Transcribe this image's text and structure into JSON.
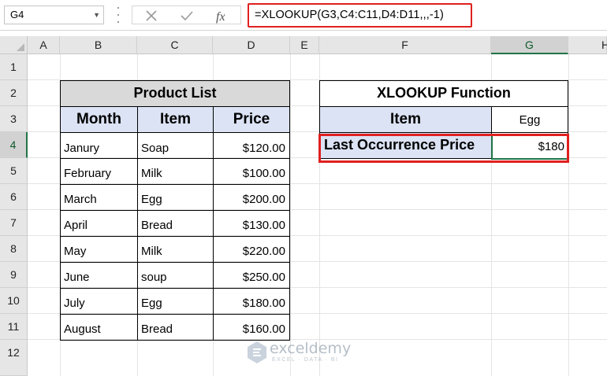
{
  "formula_bar": {
    "name_box": "G4",
    "icons": [
      "cancel-icon",
      "enter-icon",
      "function-icon"
    ],
    "formula": "=XLOOKUP(G3,C4:C11,D4:D11,,,-1)"
  },
  "columns": [
    "A",
    "B",
    "C",
    "D",
    "E",
    "F",
    "G",
    "H"
  ],
  "rows": [
    "1",
    "2",
    "3",
    "4",
    "5",
    "6",
    "7",
    "8",
    "9",
    "10",
    "11",
    "12"
  ],
  "product_table": {
    "title": "Product List",
    "headers": [
      "Month",
      "Item",
      "Price"
    ],
    "rows": [
      {
        "month": "Janury",
        "item": "Soap",
        "price": "$120.00"
      },
      {
        "month": "February",
        "item": "Milk",
        "price": "$100.00"
      },
      {
        "month": "March",
        "item": "Egg",
        "price": "$200.00"
      },
      {
        "month": "April",
        "item": "Bread",
        "price": "$130.00"
      },
      {
        "month": "May",
        "item": "Milk",
        "price": "$220.00"
      },
      {
        "month": "June",
        "item": "soup",
        "price": "$250.00"
      },
      {
        "month": "July",
        "item": "Egg",
        "price": "$180.00"
      },
      {
        "month": "August",
        "item": "Bread",
        "price": "$160.00"
      }
    ]
  },
  "xlookup_table": {
    "title": "XLOOKUP Function",
    "item_label": "Item",
    "item_value": "Egg",
    "result_label": "Last Occurrence Price",
    "result_value": "$180"
  },
  "watermark": {
    "name": "exceldemy",
    "tagline": "EXCEL · DATA · BI"
  },
  "colors": {
    "accent": "#217346",
    "highlight": "#e02020",
    "header_fill": "#dbe3f4",
    "title_fill": "#d9d9d9"
  }
}
